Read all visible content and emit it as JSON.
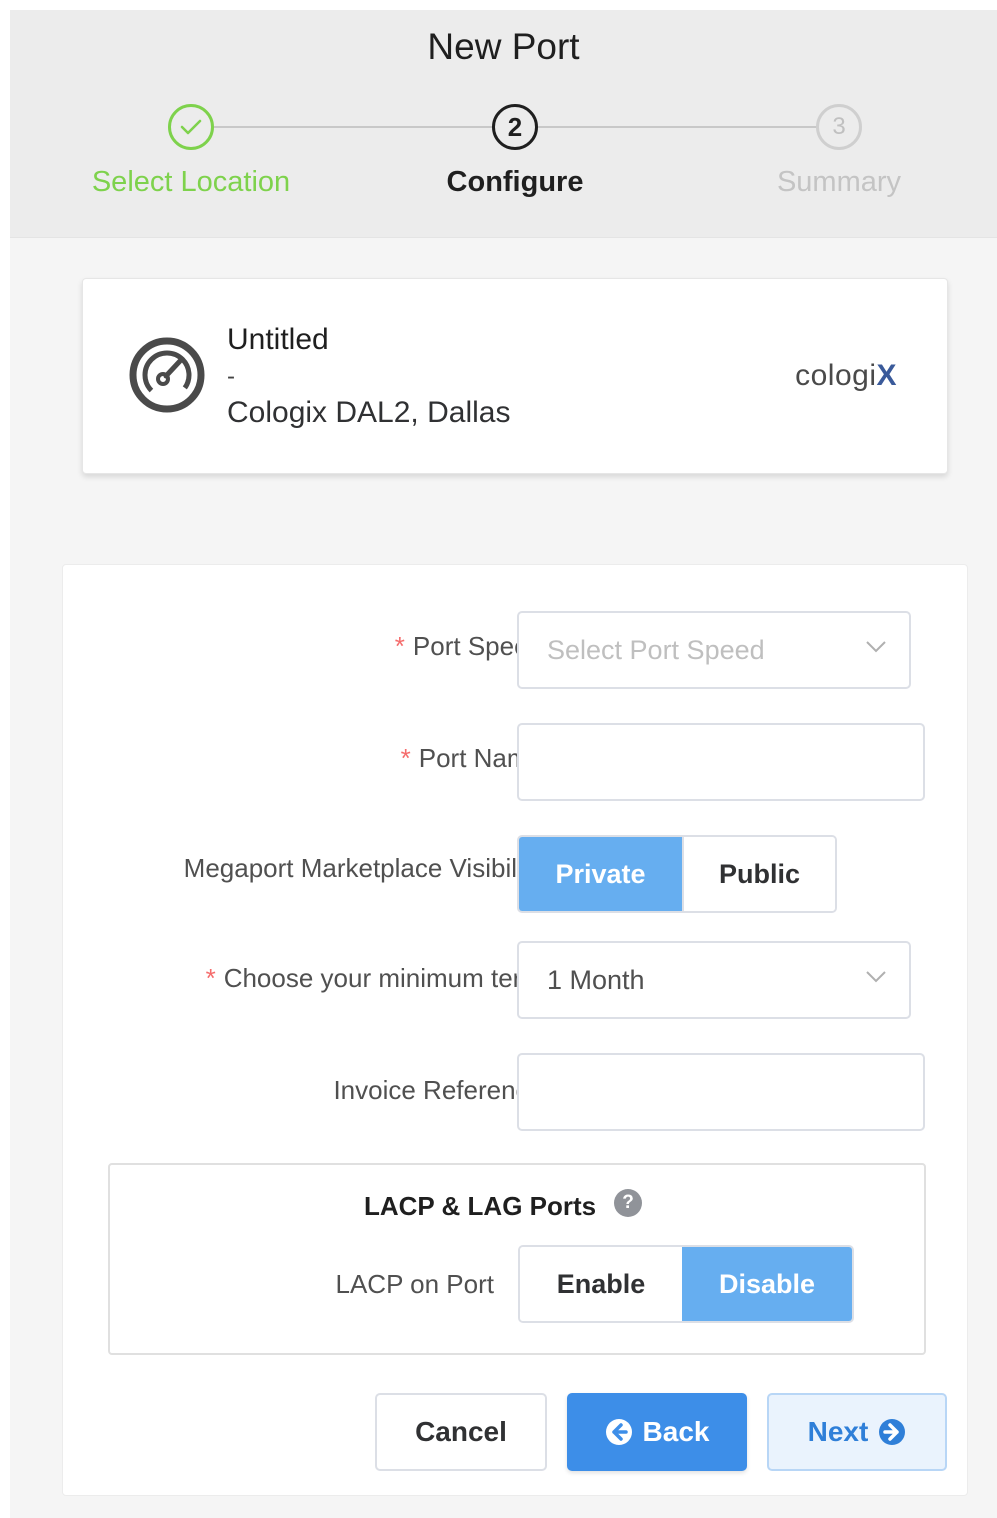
{
  "header": {
    "title": "New Port",
    "steps": [
      {
        "number": "1",
        "label": "Select Location",
        "state": "done"
      },
      {
        "number": "2",
        "label": "Configure",
        "state": "active"
      },
      {
        "number": "3",
        "label": "Summary",
        "state": "todo"
      }
    ]
  },
  "location": {
    "name": "Untitled",
    "separator": "-",
    "site": "Cologix DAL2, Dallas",
    "logo_main": "cologi",
    "logo_accent": "X",
    "icon": "speedometer-icon"
  },
  "form": {
    "port_speed": {
      "label": "Port Speed",
      "required": "*",
      "placeholder": "Select Port Speed"
    },
    "port_name": {
      "label": "Port Name",
      "required": "*",
      "value": ""
    },
    "visibility": {
      "label": "Megaport Marketplace Visibility",
      "options": [
        "Private",
        "Public"
      ],
      "selected": "Private"
    },
    "min_term": {
      "label": "Choose your minimum term",
      "required": "*",
      "value": "1 Month"
    },
    "invoice_ref": {
      "label": "Invoice Reference",
      "value": ""
    },
    "lacp": {
      "title": "LACP & LAG Ports",
      "help": "?",
      "label": "LACP on Port",
      "options": [
        "Enable",
        "Disable"
      ],
      "selected": "Disable"
    }
  },
  "actions": {
    "cancel": "Cancel",
    "back": "Back",
    "next": "Next"
  },
  "colors": {
    "done": "#7ed24c",
    "primary": "#3d8ee8",
    "selected_segment": "#66aef0",
    "required": "#f56c6c"
  }
}
